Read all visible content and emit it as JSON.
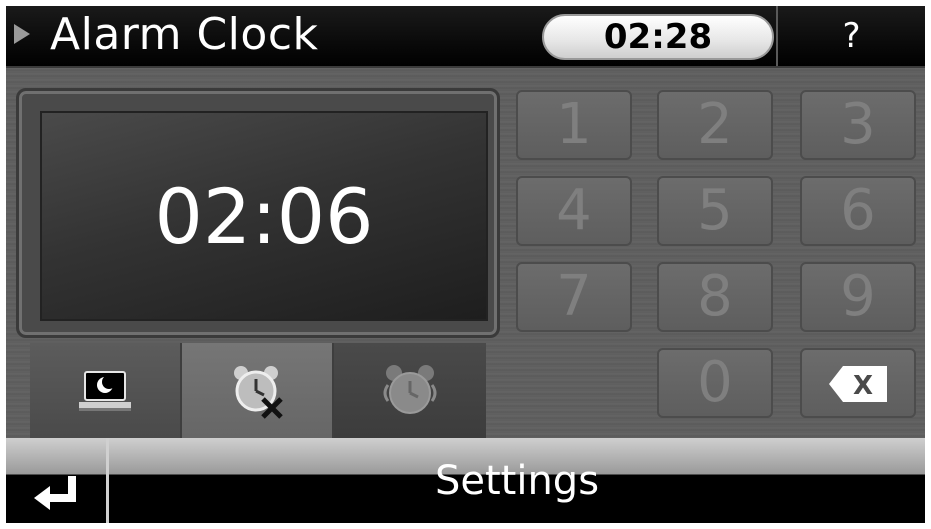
{
  "header": {
    "title": "Alarm Clock",
    "current_time": "02:28",
    "help_label": "?"
  },
  "display": {
    "alarm_time": "02:06"
  },
  "keypad": {
    "keys": [
      "1",
      "2",
      "3",
      "4",
      "5",
      "6",
      "7",
      "8",
      "9",
      "0"
    ],
    "delete_label": "X"
  },
  "modes": [
    {
      "icon": "sleep-mode-icon"
    },
    {
      "icon": "alarm-off-icon"
    },
    {
      "icon": "alarm-ringing-icon"
    }
  ],
  "footer": {
    "settings_label": "Settings"
  },
  "colors": {
    "header_bg": "#000000",
    "body_bg": "#5e5e5e",
    "text": "#ffffff"
  }
}
